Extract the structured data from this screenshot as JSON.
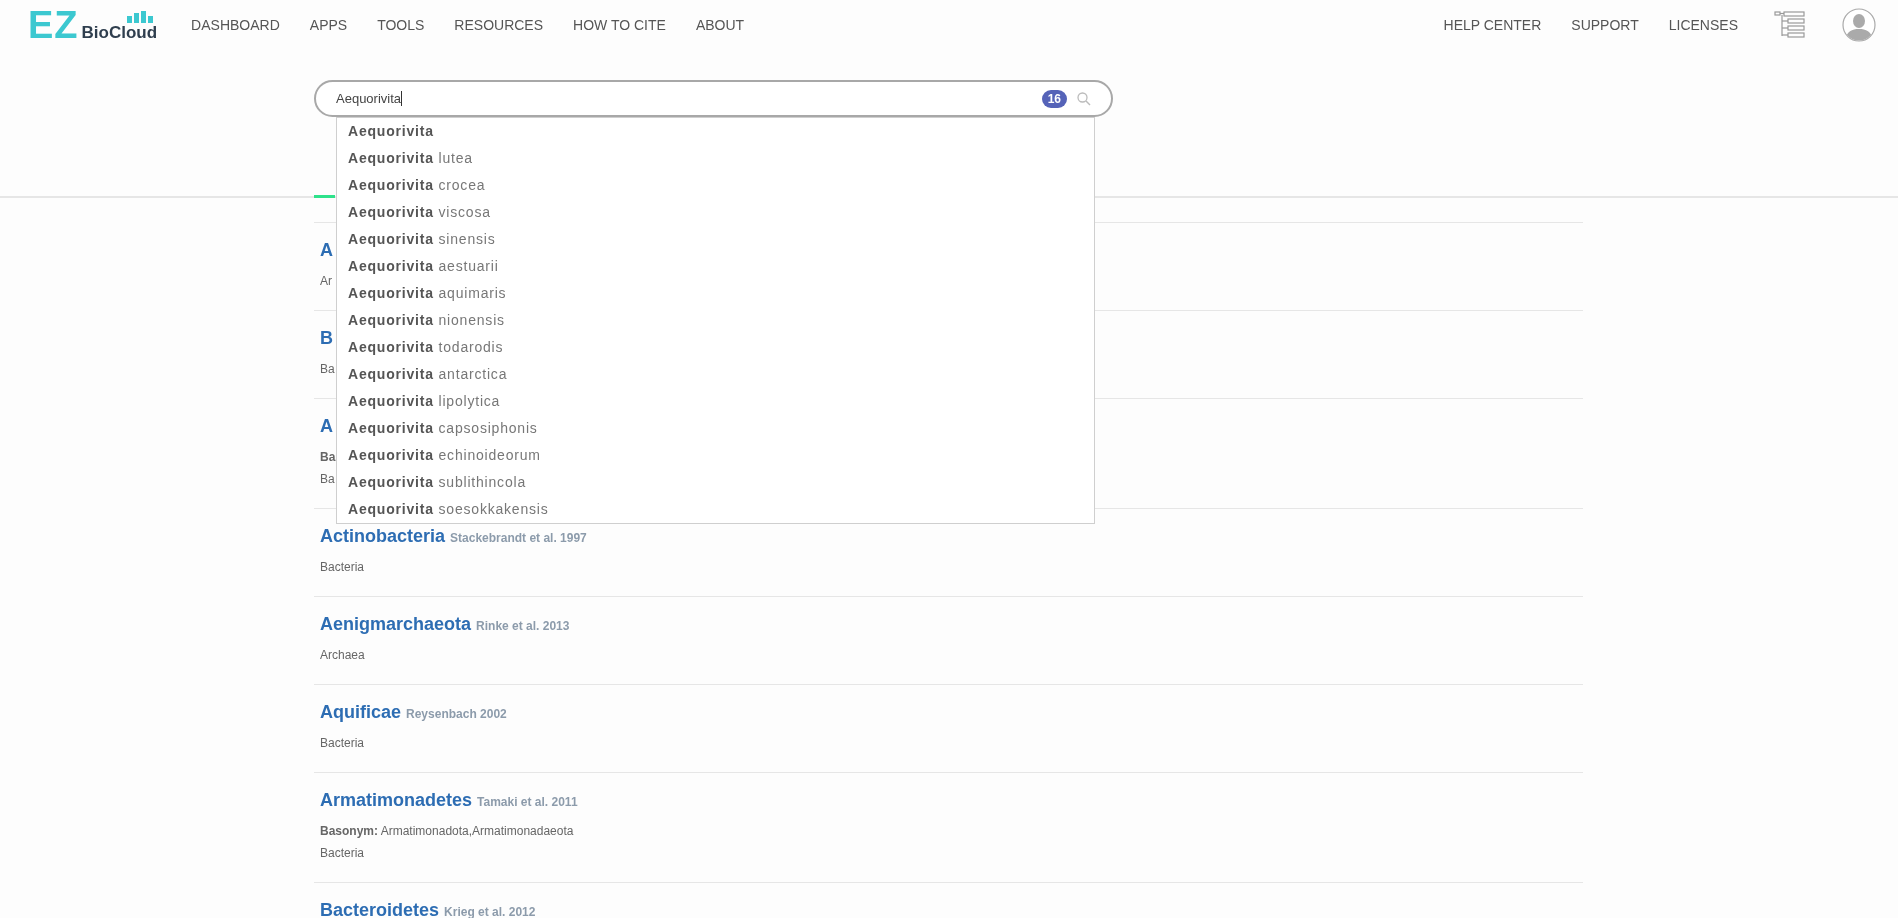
{
  "header": {
    "logo": {
      "mark": "EZ",
      "name": "BioCloud"
    },
    "nav": [
      "DASHBOARD",
      "APPS",
      "TOOLS",
      "RESOURCES",
      "HOW TO CITE",
      "ABOUT"
    ],
    "right_nav": [
      "HELP CENTER",
      "SUPPORT",
      "LICENSES"
    ]
  },
  "search": {
    "value": "Aequorivita",
    "count": "16",
    "suggestions": [
      {
        "genus": "Aequorivita"
      },
      {
        "genus": "Aequorivita",
        "species": "lutea"
      },
      {
        "genus": "Aequorivita",
        "species": "crocea"
      },
      {
        "genus": "Aequorivita",
        "species": "viscosa"
      },
      {
        "genus": "Aequorivita",
        "species": "sinensis"
      },
      {
        "genus": "Aequorivita",
        "species": "aestuarii"
      },
      {
        "genus": "Aequorivita",
        "species": "aquimaris"
      },
      {
        "genus": "Aequorivita",
        "species": "nionensis"
      },
      {
        "genus": "Aequorivita",
        "species": "todarodis"
      },
      {
        "genus": "Aequorivita",
        "species": "antarctica"
      },
      {
        "genus": "Aequorivita",
        "species": "lipolytica"
      },
      {
        "genus": "Aequorivita",
        "species": "capsosiphonis"
      },
      {
        "genus": "Aequorivita",
        "species": "echinoideorum"
      },
      {
        "genus": "Aequorivita",
        "species": "sublithincola"
      },
      {
        "genus": "Aequorivita",
        "species": "soesokkakensis"
      }
    ]
  },
  "results": [
    {
      "name": "A",
      "domain": "Ar"
    },
    {
      "name": "B",
      "domain": "Ba"
    },
    {
      "name": "A",
      "basonym": "**Ba**",
      "domain": "Ba"
    },
    {
      "name": "Actinobacteria",
      "author": "Stackebrandt et al. 1997",
      "domain": "Bacteria"
    },
    {
      "name": "Aenigmarchaeota",
      "author": "Rinke et al. 2013",
      "domain": "Archaea"
    },
    {
      "name": "Aquificae",
      "author": "Reysenbach 2002",
      "domain": "Bacteria"
    },
    {
      "name": "Armatimonadetes",
      "author": "Tamaki et al. 2011",
      "basonym": "**Basonym:** Armatimonadota,Armatimonadaeota",
      "domain": "Bacteria"
    },
    {
      "name": "Bacteroidetes",
      "author": "Krieg et al. 2012"
    }
  ]
}
